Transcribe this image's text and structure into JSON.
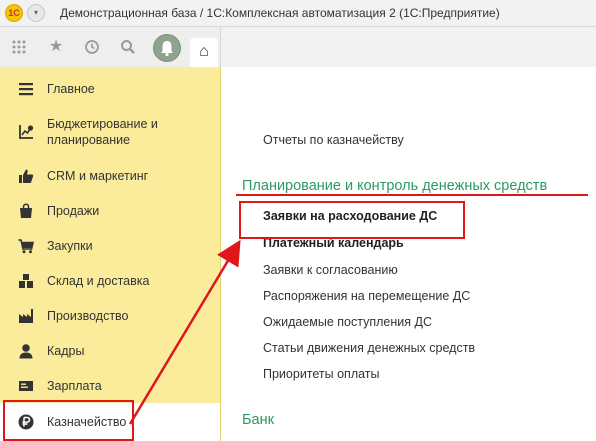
{
  "window": {
    "title": "Демонстрационная база / 1С:Комплексная автоматизация 2  (1С:Предприятие)",
    "logo_text": "1С",
    "dropdown_glyph": "▾"
  },
  "toolbar": {
    "icons": [
      "grid-icon",
      "star-icon",
      "history-icon",
      "search-icon",
      "bell-icon"
    ],
    "home_glyph": "⌂"
  },
  "sidebar": {
    "items": [
      {
        "label": "Главное",
        "icon": "menu-icon"
      },
      {
        "label": "Бюджетирование и\nпланирование",
        "icon": "budget-chart-icon"
      },
      {
        "label": "CRM и маркетинг",
        "icon": "thumbs-up-icon"
      },
      {
        "label": "Продажи",
        "icon": "shopping-bag-icon"
      },
      {
        "label": "Закупки",
        "icon": "cart-icon"
      },
      {
        "label": "Склад и доставка",
        "icon": "warehouse-icon"
      },
      {
        "label": "Производство",
        "icon": "factory-icon"
      },
      {
        "label": "Кадры",
        "icon": "person-icon"
      },
      {
        "label": "Зарплата",
        "icon": "payroll-icon"
      },
      {
        "label": "Казначейство",
        "icon": "ruble-icon",
        "active": true
      }
    ]
  },
  "main": {
    "reports_link": "Отчеты по казначейству",
    "section_planning": "Планирование и контроль денежных средств",
    "links": [
      {
        "label": "Заявки на расходование ДС",
        "bold": true
      },
      {
        "label": "Платежный календарь",
        "bold": true
      },
      {
        "label": "Заявки к согласованию",
        "bold": false
      },
      {
        "label": "Распоряжения на перемещение ДС",
        "bold": false
      },
      {
        "label": "Ожидаемые поступления ДС",
        "bold": false
      },
      {
        "label": "Статьи движения денежных средств",
        "bold": false
      },
      {
        "label": "Приоритеты оплаты",
        "bold": false
      }
    ],
    "section_bank": "Банк"
  },
  "colors": {
    "sidebar_bg": "#fbec9c",
    "section_green": "#2b9a64",
    "annotation_red": "#e0161b"
  }
}
